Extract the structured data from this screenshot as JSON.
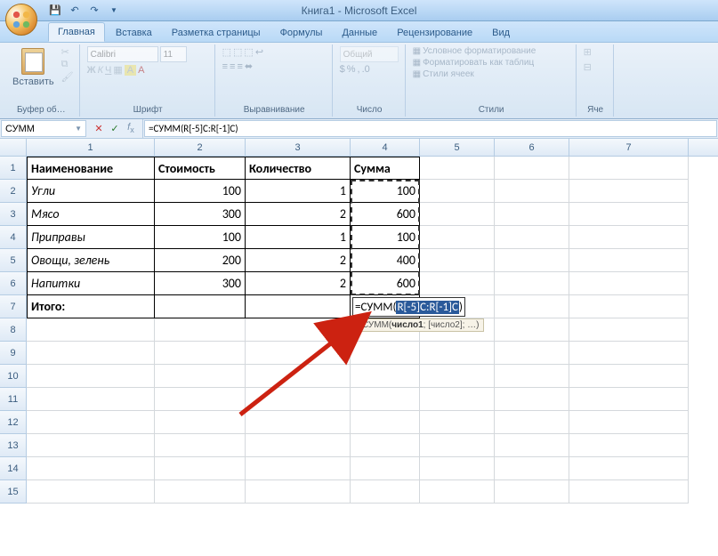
{
  "window": {
    "title": "Книга1 - Microsoft Excel"
  },
  "qat": {
    "save": "save",
    "undo": "undo",
    "redo": "redo"
  },
  "tabs": {
    "home": "Главная",
    "insert": "Вставка",
    "page_layout": "Разметка страницы",
    "formulas": "Формулы",
    "data": "Данные",
    "review": "Рецензирование",
    "view": "Вид"
  },
  "ribbon": {
    "clipboard": {
      "paste": "Вставить",
      "label": "Буфер об…"
    },
    "font": {
      "name": "Calibri",
      "size": "11",
      "label": "Шрифт"
    },
    "alignment": {
      "label": "Выравнивание"
    },
    "number": {
      "format": "Общий",
      "label": "Число"
    },
    "styles": {
      "cond_format": "Условное форматирование",
      "format_table": "Форматировать как таблиц",
      "cell_styles": "Стили ячеек",
      "label": "Стили"
    },
    "cells": {
      "label": "Яче"
    }
  },
  "namebox": "СУММ",
  "formula": "=СУММ(R[-5]C:R[-1]C)",
  "columns": [
    "1",
    "2",
    "3",
    "4",
    "5",
    "6",
    "7"
  ],
  "sheet": {
    "headers": [
      "Наименование",
      "Стоимость",
      "Количество",
      "Сумма"
    ],
    "rows": [
      {
        "name": "Угли",
        "cost": "100",
        "qty": "1",
        "sum": "100"
      },
      {
        "name": "Мясо",
        "cost": "300",
        "qty": "2",
        "sum": "600"
      },
      {
        "name": "Приправы",
        "cost": "100",
        "qty": "1",
        "sum": "100"
      },
      {
        "name": "Овощи, зелень",
        "cost": "200",
        "qty": "2",
        "sum": "400"
      },
      {
        "name": "Напитки",
        "cost": "300",
        "qty": "2",
        "sum": "600"
      }
    ],
    "total_label": "Итого:"
  },
  "editing": {
    "prefix": "=СУММ(",
    "selection": "R[-5]C:R[-1]C",
    "suffix": ")"
  },
  "tooltip": {
    "fn": "СУММ(",
    "arg1": "число1",
    "rest": "; [число2]; …)"
  }
}
